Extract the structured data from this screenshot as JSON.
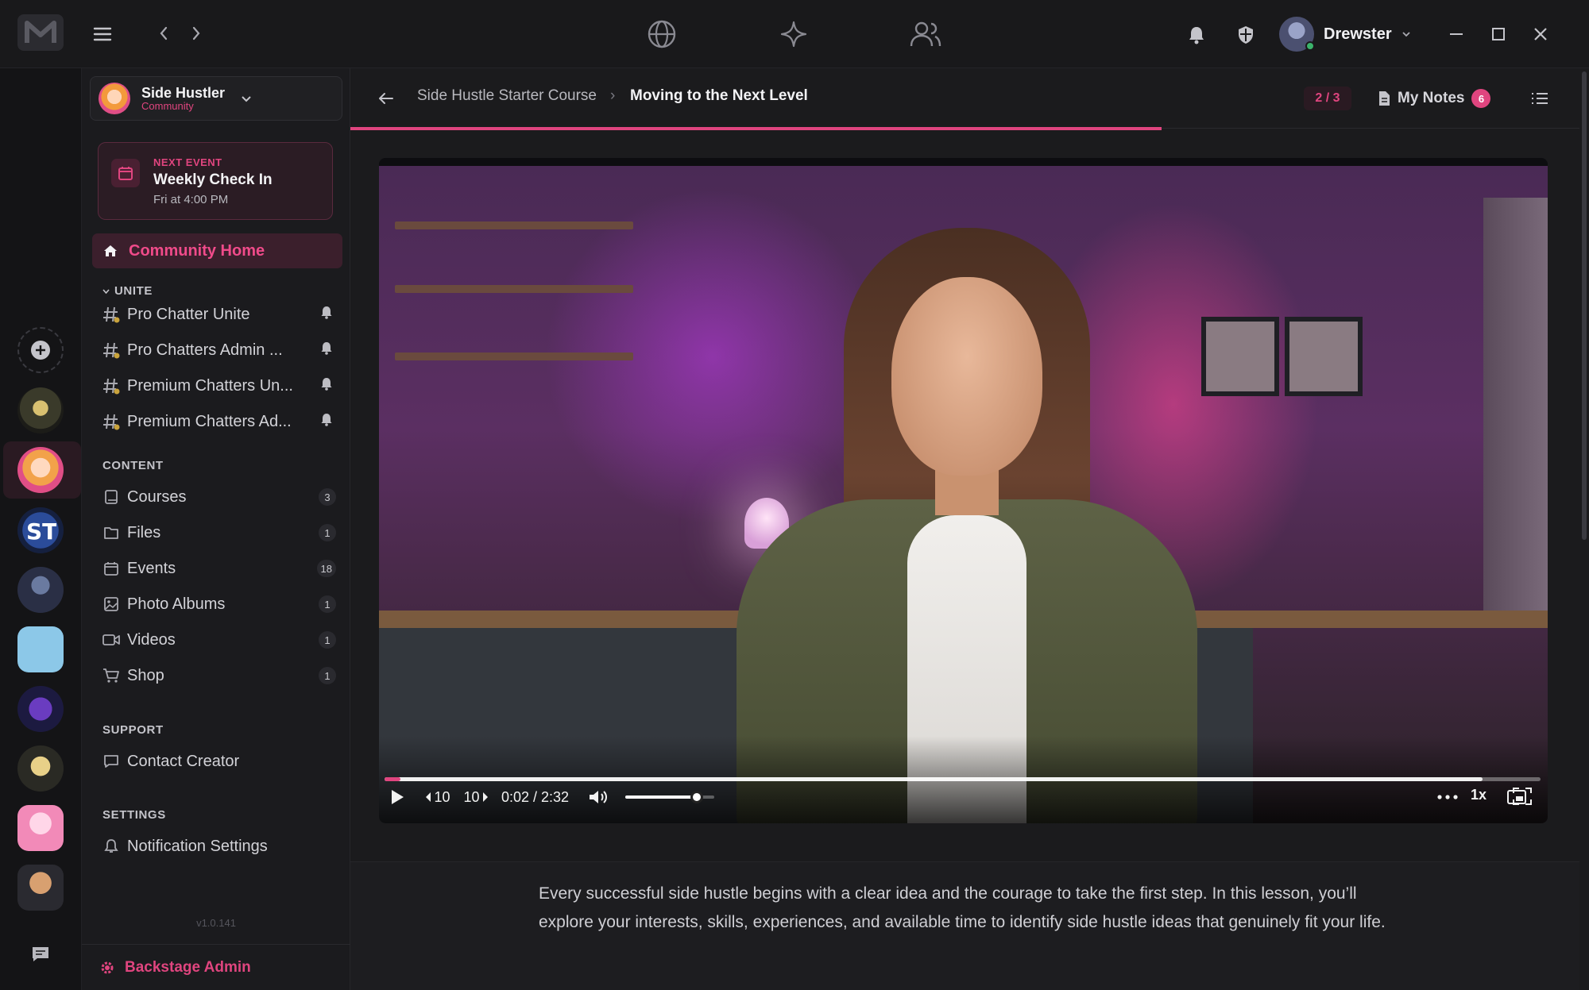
{
  "titlebar": {
    "user_name": "Drewster"
  },
  "community": {
    "name": "Side Hustler",
    "type": "Community"
  },
  "next_event": {
    "label": "NEXT EVENT",
    "title": "Weekly Check In",
    "time": "Fri at 4:00 PM"
  },
  "nav": {
    "home": "Community Home",
    "unite_header": "UNITE",
    "channels": [
      {
        "label": "Pro Chatter Unite"
      },
      {
        "label": "Pro Chatters Admin ..."
      },
      {
        "label": "Premium Chatters Un..."
      },
      {
        "label": "Premium Chatters Ad..."
      }
    ],
    "content_header": "CONTENT",
    "content": [
      {
        "label": "Courses",
        "count": "3",
        "icon": "book-icon"
      },
      {
        "label": "Files",
        "count": "1",
        "icon": "folder-icon"
      },
      {
        "label": "Events",
        "count": "18",
        "icon": "calendar-icon"
      },
      {
        "label": "Photo Albums",
        "count": "1",
        "icon": "image-icon"
      },
      {
        "label": "Videos",
        "count": "1",
        "icon": "video-icon"
      },
      {
        "label": "Shop",
        "count": "1",
        "icon": "cart-icon"
      }
    ],
    "support_header": "SUPPORT",
    "support": [
      {
        "label": "Contact Creator"
      }
    ],
    "settings_header": "SETTINGS",
    "settings": [
      {
        "label": "Notification Settings"
      }
    ],
    "version": "v1.0.141",
    "admin": "Backstage Admin"
  },
  "lesson": {
    "course": "Side Hustle Starter Course",
    "separator": "›",
    "title": "Moving to the Next Level",
    "counter": "2 / 3",
    "notes_label": "My Notes",
    "notes_count": "6",
    "progress": 0.66
  },
  "player": {
    "back_label": "10",
    "forward_label": "10",
    "time": "0:02 / 2:32",
    "speed": "1x",
    "played_fraction": 0.014,
    "buffered_fraction": 0.95,
    "volume": 0.8
  },
  "description": "Every successful side hustle begins with a clear idea and the courage to take the first step. In this lesson, you’ll explore your interests, skills, experiences, and available time to identify side hustle ideas that genuinely fit your life.",
  "colors": {
    "accent": "#e0457f",
    "background": "#1b1b1d"
  }
}
